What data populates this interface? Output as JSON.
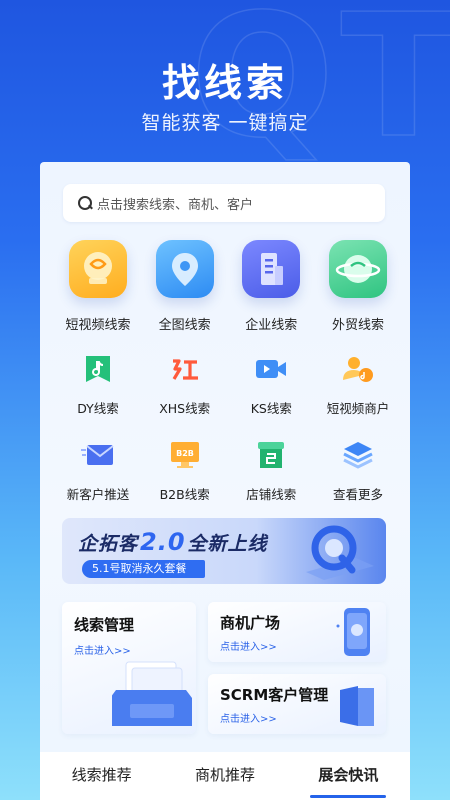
{
  "hero": {
    "title": "找线索",
    "subtitle": "智能获客 一键搞定",
    "watermark": "QT"
  },
  "search": {
    "placeholder": "点击搜索线索、商机、客户"
  },
  "primary_features": [
    {
      "label": "短视频线索",
      "icon": "short-video-icon",
      "color": "#ffb62a"
    },
    {
      "label": "全图线索",
      "icon": "map-pin-icon",
      "color": "#3d96f5"
    },
    {
      "label": "企业线索",
      "icon": "building-icon",
      "color": "#5867ec"
    },
    {
      "label": "外贸线索",
      "icon": "globe-icon",
      "color": "#39c988"
    }
  ],
  "secondary_features": [
    {
      "label": "DY线索",
      "icon": "douyin-icon"
    },
    {
      "label": "XHS线索",
      "icon": "xiaohongshu-icon"
    },
    {
      "label": "KS线索",
      "icon": "kuaishou-icon"
    },
    {
      "label": "短视频商户",
      "icon": "merchant-user-icon"
    },
    {
      "label": "新客户推送",
      "icon": "mail-push-icon"
    },
    {
      "label": "B2B线索",
      "icon": "b2b-icon"
    },
    {
      "label": "店铺线索",
      "icon": "shop-icon"
    },
    {
      "label": "查看更多",
      "icon": "layers-icon"
    }
  ],
  "banner": {
    "title_prefix": "企拓客",
    "version": "2.0",
    "title_suffix": "全新上线",
    "pill": "5.1号取消永久套餐"
  },
  "tiles": {
    "leads_management": {
      "title": "线索管理",
      "link": "点击进入>>"
    },
    "opportunity_plaza": {
      "title": "商机广场",
      "link": "点击进入>>"
    },
    "scrm": {
      "title": "SCRM客户管理",
      "link": "点击进入>>"
    }
  },
  "tabs": [
    {
      "label": "线索推荐",
      "active": false
    },
    {
      "label": "商机推荐",
      "active": false
    },
    {
      "label": "展会快讯",
      "active": true
    }
  ],
  "colors": {
    "accent": "#2463ea",
    "background_top": "#1f56e0",
    "background_bottom": "#8ee0fb"
  }
}
